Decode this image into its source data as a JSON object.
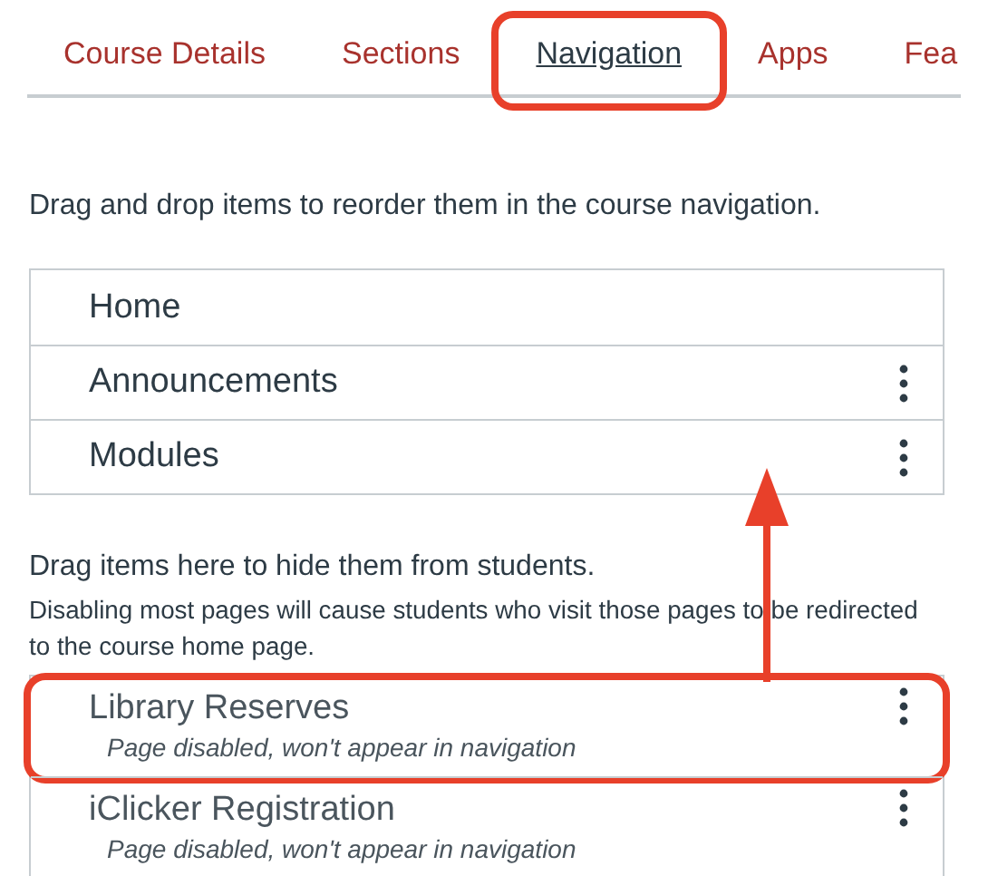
{
  "tabs": [
    {
      "label": "Course Details",
      "selected": false,
      "highlighted": false
    },
    {
      "label": "Sections",
      "selected": false,
      "highlighted": false
    },
    {
      "label": "Navigation",
      "selected": true,
      "highlighted": true
    },
    {
      "label": "Apps",
      "selected": false,
      "highlighted": false
    },
    {
      "label": "Fea",
      "selected": false,
      "highlighted": false
    }
  ],
  "enabled_intro": "Drag and drop items to reorder them in the course navigation.",
  "enabled_items": [
    {
      "label": "Home",
      "has_menu": false
    },
    {
      "label": "Announcements",
      "has_menu": true
    },
    {
      "label": "Modules",
      "has_menu": true
    }
  ],
  "disabled_title": "Drag items here to hide them from students.",
  "disabled_note": "Disabling most pages will cause students who visit those pages to be redirected to the course home page.",
  "disabled_items": [
    {
      "label": "Library Reserves",
      "status": "Page disabled, won't appear in navigation",
      "highlighted": true
    },
    {
      "label": "iClicker Registration",
      "status": "Page disabled, won't appear in navigation",
      "highlighted": false
    }
  ]
}
